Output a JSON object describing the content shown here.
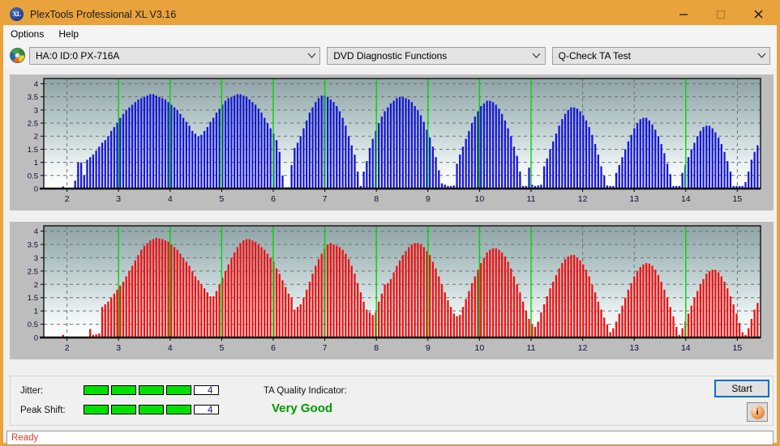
{
  "window": {
    "title": "PlexTools Professional XL V3.16",
    "app_icon": "xl-disc-icon",
    "icon_text": "XL",
    "accent_color": "#e8a33d",
    "minimize_label": "—",
    "maximize_label": "□",
    "close_label": "✕"
  },
  "menu": {
    "items": [
      {
        "label": "Options"
      },
      {
        "label": "Help"
      }
    ]
  },
  "toolbar": {
    "drive_icon": "disc-icon",
    "drive_select": {
      "value": "HA:0 ID:0  PX-716A",
      "options": [
        "HA:0 ID:0  PX-716A"
      ]
    },
    "function_select": {
      "value": "DVD Diagnostic Functions",
      "options": [
        "DVD Diagnostic Functions"
      ]
    },
    "test_select": {
      "value": "Q-Check TA Test",
      "options": [
        "Q-Check TA Test"
      ]
    },
    "arrow_glyph": "⌄"
  },
  "results": {
    "jitter_label": "Jitter:",
    "jitter_value": "4",
    "jitter_filled": 4,
    "jitter_total": 5,
    "peak_shift_label": "Peak Shift:",
    "peak_shift_value": "4",
    "peak_shift_filled": 4,
    "peak_shift_total": 5,
    "ta_quality_label": "TA Quality Indicator:",
    "ta_quality_value": "Very Good",
    "ta_quality_color": "#009900",
    "bar_on_color": "#00e000",
    "start_button": "Start",
    "info_button": "info-icon",
    "info_glyph": "i"
  },
  "status": {
    "text": "Ready",
    "color": "#e23b2e"
  },
  "chart_data": [
    {
      "type": "bar",
      "id": "jitter-histogram",
      "title": "",
      "series_color": "#1616d8",
      "marker_color": "#00d800",
      "xlabel": "",
      "ylabel": "",
      "xlim": [
        1.55,
        15.45
      ],
      "ylim": [
        0,
        4.2
      ],
      "yticks": [
        0,
        0.5,
        1,
        1.5,
        2,
        2.5,
        3,
        3.5,
        4
      ],
      "ytick_labels": [
        "0",
        "0.5",
        "1",
        "1.5",
        "2",
        "2.5",
        "3",
        "3.5",
        "4"
      ],
      "xticks": [
        2,
        3,
        4,
        5,
        6,
        7,
        8,
        9,
        10,
        11,
        12,
        13,
        14,
        15
      ],
      "xtick_labels": [
        "2",
        "3",
        "4",
        "5",
        "6",
        "7",
        "8",
        "9",
        "10",
        "11",
        "12",
        "13",
        "14",
        "15"
      ],
      "grid": true,
      "markers": [
        3,
        4,
        5,
        6,
        7,
        8,
        9,
        10,
        11,
        14
      ],
      "bar_step": 0.0583,
      "x_start": 1.75,
      "values": [
        0,
        0,
        0,
        0.08,
        0,
        0,
        0,
        0.3,
        1.0,
        1.0,
        0.5,
        1.1,
        1.2,
        1.3,
        1.45,
        1.6,
        1.75,
        1.85,
        2.0,
        2.2,
        2.35,
        2.5,
        2.7,
        2.85,
        3.0,
        3.1,
        3.2,
        3.3,
        3.4,
        3.45,
        3.5,
        3.55,
        3.6,
        3.6,
        3.55,
        3.5,
        3.45,
        3.4,
        3.3,
        3.2,
        3.1,
        3.0,
        2.85,
        2.7,
        2.55,
        2.4,
        2.2,
        2.1,
        2.0,
        2.05,
        2.2,
        2.35,
        2.55,
        2.7,
        2.9,
        3.05,
        3.2,
        3.35,
        3.45,
        3.5,
        3.55,
        3.6,
        3.6,
        3.55,
        3.5,
        3.4,
        3.3,
        3.2,
        3.05,
        2.9,
        2.7,
        2.5,
        2.3,
        2.1,
        1.85,
        1.4,
        0.5,
        0.05,
        0.05,
        0.9,
        1.55,
        1.75,
        2.0,
        2.3,
        2.6,
        2.9,
        3.1,
        3.3,
        3.45,
        3.55,
        3.55,
        3.5,
        3.4,
        3.3,
        3.15,
        2.95,
        2.7,
        2.4,
        2.0,
        1.65,
        1.3,
        0.65,
        0.1,
        0.65,
        1.05,
        1.55,
        1.9,
        2.2,
        2.5,
        2.75,
        2.95,
        3.1,
        3.25,
        3.35,
        3.45,
        3.5,
        3.5,
        3.45,
        3.4,
        3.3,
        3.15,
        3.0,
        2.8,
        2.55,
        2.25,
        1.95,
        1.6,
        1.2,
        0.7,
        0.2,
        0.15,
        0.1,
        0.1,
        0.12,
        0.95,
        1.3,
        1.6,
        1.9,
        2.2,
        2.5,
        2.75,
        2.95,
        3.15,
        3.25,
        3.35,
        3.35,
        3.3,
        3.2,
        3.05,
        2.85,
        2.6,
        2.3,
        2.0,
        1.6,
        1.25,
        0.65,
        0.1,
        0.1,
        0.8,
        0.15,
        0.1,
        0.12,
        0.15,
        0.85,
        1.15,
        1.5,
        1.8,
        2.1,
        2.4,
        2.65,
        2.85,
        3.0,
        3.1,
        3.1,
        3.05,
        2.95,
        2.8,
        2.6,
        2.35,
        2.05,
        1.7,
        1.3,
        0.85,
        0.5,
        0.12,
        0.1,
        0.1,
        0.6,
        0.9,
        1.2,
        1.5,
        1.8,
        2.05,
        2.3,
        2.5,
        2.65,
        2.7,
        2.7,
        2.6,
        2.45,
        2.25,
        2.0,
        1.7,
        1.35,
        0.95,
        0.55,
        0.1,
        0.1,
        0.1,
        0.6,
        0.9,
        1.2,
        1.5,
        1.75,
        2.0,
        2.2,
        2.35,
        2.4,
        2.4,
        2.3,
        2.15,
        1.95,
        1.7,
        1.4,
        1.05,
        0.65,
        0.1,
        0.1,
        0.1,
        0.1,
        0.25,
        0.65,
        1.1,
        1.4,
        1.65,
        1.75,
        1.75,
        1.65,
        1.45,
        1.15,
        0.15,
        0.1,
        0.12,
        0,
        0,
        0,
        0,
        0,
        0,
        0,
        0,
        0,
        0,
        0,
        0,
        0,
        0,
        0,
        0,
        0,
        0,
        0,
        0,
        0,
        0,
        0,
        0,
        0,
        0,
        0,
        0,
        0,
        0,
        0,
        0,
        0,
        0,
        0,
        0,
        0,
        0,
        0,
        0,
        0,
        0,
        0,
        0,
        0,
        0,
        0,
        0,
        0,
        0,
        0,
        0,
        0,
        0,
        0.1,
        0.6,
        0.9,
        1.1,
        1.35,
        1.55,
        1.75,
        1.95,
        2.1,
        2.2,
        2.15,
        2.05,
        1.9,
        1.65,
        1.35,
        1.0,
        0.05,
        0,
        0,
        0,
        0,
        0,
        0,
        0,
        0,
        0,
        0,
        0,
        0,
        0,
        0,
        0,
        0,
        0,
        0,
        0,
        0,
        0,
        0,
        0,
        0,
        0,
        0,
        0
      ]
    },
    {
      "type": "bar",
      "id": "peak-shift-histogram",
      "title": "",
      "series_color": "#f01010",
      "marker_color": "#00d800",
      "xlabel": "",
      "ylabel": "",
      "xlim": [
        1.55,
        15.45
      ],
      "ylim": [
        0,
        4.2
      ],
      "yticks": [
        0,
        0.5,
        1,
        1.5,
        2,
        2.5,
        3,
        3.5,
        4
      ],
      "ytick_labels": [
        "0",
        "0.5",
        "1",
        "1.5",
        "2",
        "2.5",
        "3",
        "3.5",
        "4"
      ],
      "xticks": [
        2,
        3,
        4,
        5,
        6,
        7,
        8,
        9,
        10,
        11,
        12,
        13,
        14,
        15
      ],
      "xtick_labels": [
        "2",
        "3",
        "4",
        "5",
        "6",
        "7",
        "8",
        "9",
        "10",
        "11",
        "12",
        "13",
        "14",
        "15"
      ],
      "grid": true,
      "markers": [
        3,
        4,
        5,
        6,
        7,
        8,
        9,
        10,
        11,
        14
      ],
      "bar_step": 0.0583,
      "x_start": 1.75,
      "values": [
        0,
        0,
        0,
        0.1,
        0,
        0,
        0,
        0,
        0,
        0,
        0,
        0,
        0.32,
        0.1,
        0.12,
        0.15,
        1.15,
        1.25,
        1.35,
        1.5,
        1.65,
        1.8,
        1.95,
        2.1,
        2.3,
        2.5,
        2.7,
        2.9,
        3.1,
        3.3,
        3.45,
        3.55,
        3.65,
        3.7,
        3.75,
        3.72,
        3.7,
        3.65,
        3.6,
        3.5,
        3.4,
        3.3,
        3.15,
        3.0,
        2.85,
        2.7,
        2.5,
        2.3,
        2.15,
        2.0,
        1.85,
        1.7,
        1.55,
        1.55,
        1.75,
        2.0,
        2.25,
        2.5,
        2.75,
        3.0,
        3.2,
        3.4,
        3.55,
        3.65,
        3.7,
        3.7,
        3.65,
        3.6,
        3.5,
        3.4,
        3.3,
        3.15,
        3.0,
        2.85,
        2.6,
        2.4,
        2.15,
        1.9,
        1.65,
        1.5,
        1.05,
        1.15,
        1.25,
        1.5,
        1.8,
        2.1,
        2.4,
        2.7,
        2.95,
        3.15,
        3.35,
        3.5,
        3.55,
        3.5,
        3.45,
        3.4,
        3.3,
        3.15,
        2.95,
        2.7,
        2.4,
        2.05,
        1.7,
        1.35,
        1.05,
        0.95,
        0.85,
        0.95,
        1.35,
        1.65,
        2.0,
        2.05,
        2.2,
        2.45,
        2.7,
        2.9,
        3.1,
        3.25,
        3.4,
        3.5,
        3.55,
        3.55,
        3.5,
        3.4,
        3.25,
        3.1,
        2.85,
        2.6,
        2.3,
        2.0,
        1.7,
        1.4,
        1.15,
        0.9,
        0.8,
        0.85,
        1.15,
        1.45,
        1.75,
        2.05,
        2.3,
        2.55,
        2.8,
        3.0,
        3.2,
        3.3,
        3.35,
        3.35,
        3.3,
        3.2,
        3.05,
        2.85,
        2.6,
        2.3,
        2.0,
        1.7,
        1.35,
        1.0,
        0.7,
        0.5,
        0.4,
        0.6,
        0.95,
        1.25,
        1.55,
        1.85,
        2.1,
        2.35,
        2.6,
        2.8,
        2.95,
        3.05,
        3.1,
        3.1,
        3.0,
        2.9,
        2.75,
        2.55,
        2.3,
        2.0,
        1.7,
        1.35,
        1.05,
        0.75,
        0.5,
        0.2,
        0.35,
        0.6,
        0.9,
        1.2,
        1.5,
        1.8,
        2.05,
        2.3,
        2.5,
        2.65,
        2.75,
        2.8,
        2.78,
        2.7,
        2.55,
        2.35,
        2.1,
        1.8,
        1.5,
        1.15,
        0.8,
        0.4,
        0.1,
        0.35,
        0.6,
        0.9,
        1.2,
        1.5,
        1.75,
        2.0,
        2.2,
        2.4,
        2.5,
        2.55,
        2.55,
        2.45,
        2.3,
        2.1,
        1.85,
        1.55,
        1.25,
        0.9,
        0.55,
        0.2,
        0.1,
        0.35,
        0.7,
        1.05,
        1.3,
        1.5,
        1.65,
        1.7,
        1.7,
        1.6,
        1.45,
        1.2,
        0.2,
        0.15,
        0.1,
        0,
        0,
        0,
        0,
        0,
        0,
        0,
        0,
        0,
        0,
        0,
        0,
        0,
        0,
        0,
        0,
        0,
        0,
        0,
        0,
        0,
        0,
        0,
        0,
        0,
        0,
        0,
        0,
        0,
        0,
        0,
        0,
        0,
        0,
        0,
        0,
        0,
        0,
        0,
        0,
        0,
        0,
        0,
        0,
        0,
        0,
        0,
        0,
        0,
        0,
        0,
        0,
        0,
        0.12,
        0.15,
        0.2,
        0.45,
        0.65,
        0.85,
        1.0,
        1.1,
        1.15,
        1.1,
        1.0,
        0.85,
        0.1,
        0,
        0,
        0,
        0,
        0,
        0,
        0,
        0,
        0,
        0,
        0,
        0,
        0,
        0,
        0,
        0,
        0,
        0,
        0,
        0,
        0,
        0,
        0,
        0,
        0,
        0,
        0,
        0,
        0,
        0
      ]
    }
  ]
}
